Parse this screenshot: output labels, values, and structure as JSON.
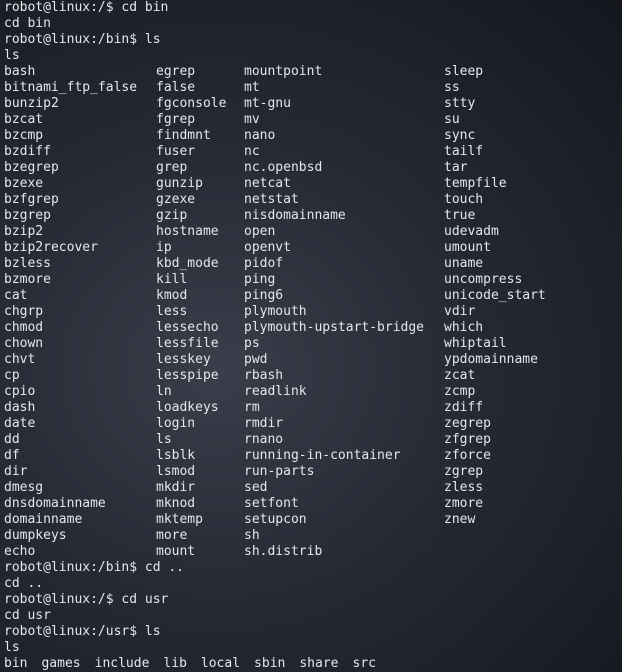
{
  "terminal": {
    "lines_before": [
      "robot@linux:/$ cd bin",
      "cd bin",
      "robot@linux:/bin$ ls",
      "ls"
    ],
    "bin_listing": [
      "bash",
      "egrep",
      "mountpoint",
      "sleep",
      "bitnami_ftp_false",
      "false",
      "mt",
      "ss",
      "bunzip2",
      "fgconsole",
      "mt-gnu",
      "stty",
      "bzcat",
      "fgrep",
      "mv",
      "su",
      "bzcmp",
      "findmnt",
      "nano",
      "sync",
      "bzdiff",
      "fuser",
      "nc",
      "tailf",
      "bzegrep",
      "grep",
      "nc.openbsd",
      "tar",
      "bzexe",
      "gunzip",
      "netcat",
      "tempfile",
      "bzfgrep",
      "gzexe",
      "netstat",
      "touch",
      "bzgrep",
      "gzip",
      "nisdomainname",
      "true",
      "bzip2",
      "hostname",
      "open",
      "udevadm",
      "bzip2recover",
      "ip",
      "openvt",
      "umount",
      "bzless",
      "kbd_mode",
      "pidof",
      "uname",
      "bzmore",
      "kill",
      "ping",
      "uncompress",
      "cat",
      "kmod",
      "ping6",
      "unicode_start",
      "chgrp",
      "less",
      "plymouth",
      "vdir",
      "chmod",
      "lessecho",
      "plymouth-upstart-bridge",
      "which",
      "chown",
      "lessfile",
      "ps",
      "whiptail",
      "chvt",
      "lesskey",
      "pwd",
      "ypdomainname",
      "cp",
      "lesspipe",
      "rbash",
      "zcat",
      "cpio",
      "ln",
      "readlink",
      "zcmp",
      "dash",
      "loadkeys",
      "rm",
      "zdiff",
      "date",
      "login",
      "rmdir",
      "zegrep",
      "dd",
      "ls",
      "rnano",
      "zfgrep",
      "df",
      "lsblk",
      "running-in-container",
      "zforce",
      "dir",
      "lsmod",
      "run-parts",
      "zgrep",
      "dmesg",
      "mkdir",
      "sed",
      "zless",
      "dnsdomainname",
      "mknod",
      "setfont",
      "zmore",
      "domainname",
      "mktemp",
      "setupcon",
      "znew",
      "dumpkeys",
      "more",
      "sh",
      "",
      "echo",
      "mount",
      "sh.distrib",
      ""
    ],
    "lines_after": [
      "robot@linux:/bin$ cd ..",
      "cd ..",
      "robot@linux:/$ cd usr",
      "cd usr",
      "robot@linux:/usr$ ls",
      "ls"
    ],
    "usr_listing": [
      "bin",
      "games",
      "include",
      "lib",
      "local",
      "sbin",
      "share",
      "src"
    ]
  }
}
